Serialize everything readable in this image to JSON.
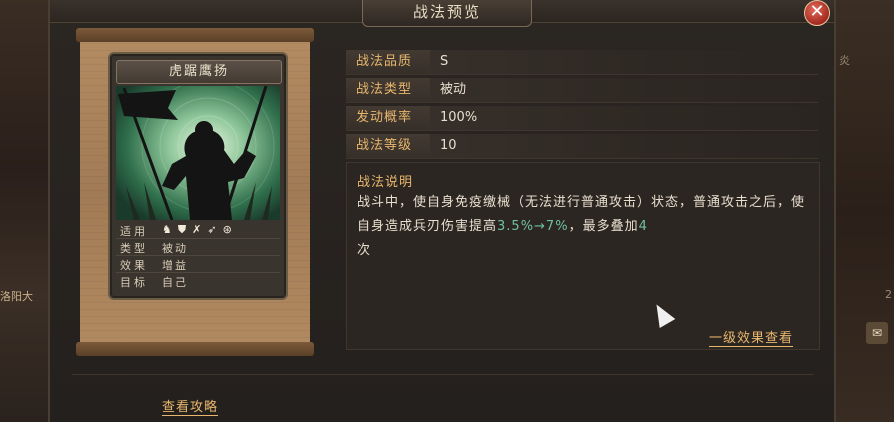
{
  "background": {
    "left_text": "洛阳大",
    "right_text_top": "炎",
    "right_text_bottom": "2"
  },
  "dialog": {
    "title": "战法预览",
    "close_symbol": "✕"
  },
  "skill_card": {
    "name": "虎踞鹰扬",
    "rows": {
      "applicable_label": "适用",
      "applicable_icons": [
        "horse-icon",
        "shield-icon",
        "bow-icon",
        "spear-icon",
        "wheel-icon"
      ],
      "type_label": "类型",
      "type_value": "被动",
      "effect_label": "效果",
      "effect_value": "增益",
      "target_label": "目标",
      "target_value": "自己"
    }
  },
  "attributes": [
    {
      "label": "战法品质",
      "value": "S"
    },
    {
      "label": "战法类型",
      "value": "被动"
    },
    {
      "label": "发动概率",
      "value": "100%"
    },
    {
      "label": "战法等级",
      "value": "10"
    }
  ],
  "description": {
    "title": "战法说明",
    "text_before": "战斗中，使自身免疫缴械（无法进行普通攻击）状态，普通攻击之后，使自身造成兵刃伤害提高",
    "highlight": "3.5%→7%",
    "text_after": "，最多叠加",
    "highlight2": "4",
    "text_end": "次"
  },
  "links": {
    "level_effects": "一级效果查看",
    "guide": "查看攻略"
  },
  "colors": {
    "gold": "#e8b76d",
    "highlight": "#6fc0a2",
    "close_red": "#c23a2c"
  }
}
